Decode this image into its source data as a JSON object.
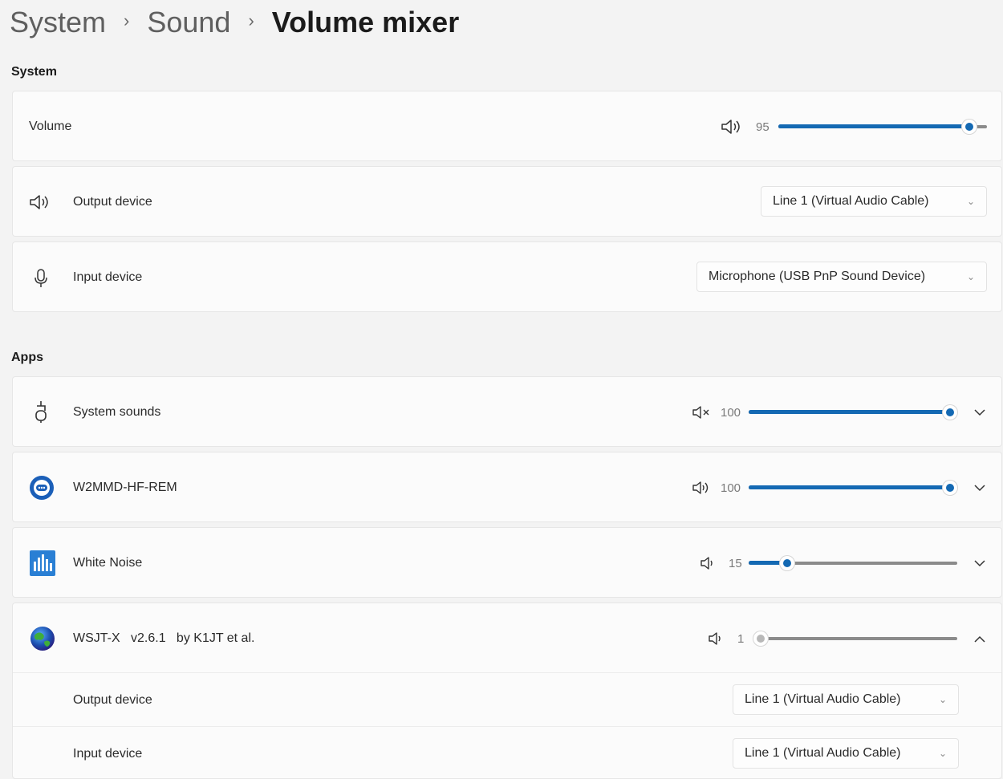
{
  "breadcrumb": {
    "system": "System",
    "sound": "Sound",
    "current": "Volume mixer",
    "separator": "›"
  },
  "system_section": {
    "label": "System",
    "volume": {
      "label": "Volume",
      "value": "95",
      "level": 0.95,
      "icon": "speaker-high-icon"
    },
    "output": {
      "label": "Output device",
      "value": "Line 1 (Virtual Audio Cable)",
      "icon": "speaker-icon"
    },
    "input": {
      "label": "Input device",
      "value": "Microphone (USB PnP Sound Device)",
      "icon": "microphone-icon"
    }
  },
  "apps_section": {
    "label": "Apps",
    "apps": [
      {
        "name": "System sounds",
        "value": "100",
        "level": 1.0,
        "icon": "system-sounds-icon",
        "volume_icon": "speaker-muted-icon",
        "expanded": false
      },
      {
        "name": "W2MMD-HF-REM",
        "value": "100",
        "level": 1.0,
        "icon": "remote-app-icon",
        "volume_icon": "speaker-high-icon",
        "expanded": false
      },
      {
        "name": "White Noise",
        "value": "15",
        "level": 0.15,
        "icon": "white-noise-app-icon",
        "volume_icon": "speaker-low-icon",
        "expanded": false
      },
      {
        "name": "WSJT-X   v2.6.1   by K1JT et al.",
        "value": "1",
        "level": 0.01,
        "icon": "wsjtx-globe-icon",
        "volume_icon": "speaker-low-icon",
        "expanded": true
      }
    ],
    "expanded_app": {
      "output": {
        "label": "Output device",
        "value": "Line 1 (Virtual Audio Cable)"
      },
      "input": {
        "label": "Input device",
        "value": "Line 1 (Virtual Audio Cable)"
      }
    }
  },
  "colors": {
    "accent": "#1469b3",
    "card": "#fbfbfb",
    "background": "#f3f3f3"
  }
}
